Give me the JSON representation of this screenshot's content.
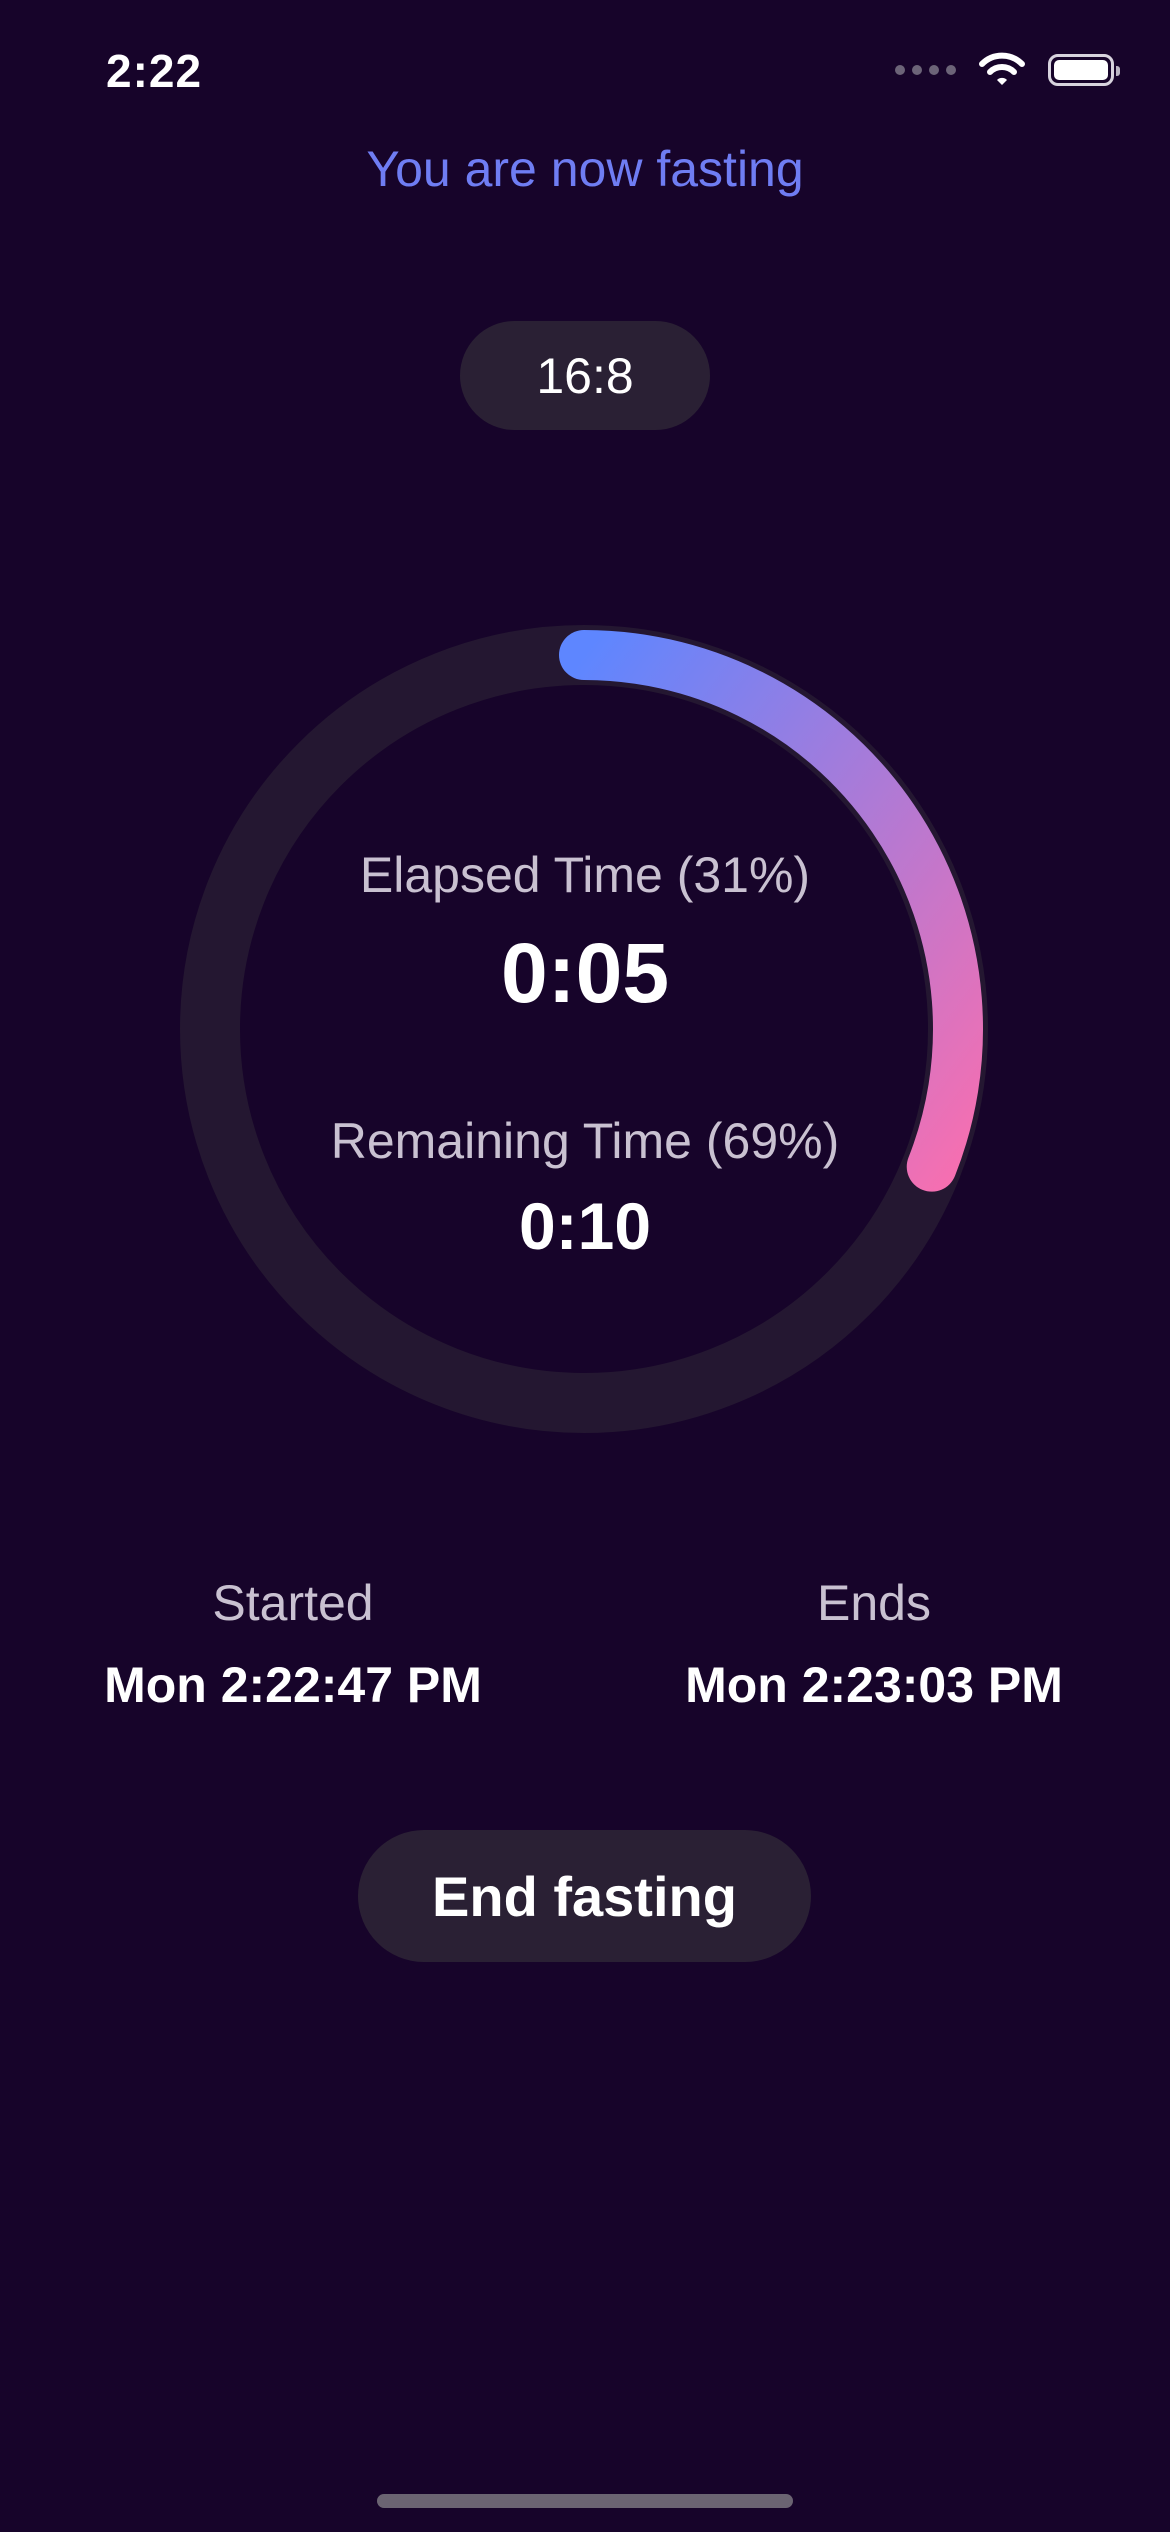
{
  "status_bar": {
    "time": "2:22",
    "icons": [
      "signal-dots-icon",
      "wifi-icon",
      "battery-icon"
    ]
  },
  "header": {
    "title": "You are now fasting"
  },
  "plan": {
    "label": "16:8"
  },
  "progress": {
    "elapsed_label": "Elapsed Time (31%)",
    "elapsed_value": "0:05",
    "remaining_label": "Remaining Time (69%)",
    "remaining_value": "0:10",
    "fraction": 0.31
  },
  "schedule": {
    "started_label": "Started",
    "started_value": "Mon 2:22:47 PM",
    "ends_label": "Ends",
    "ends_value": "Mon 2:23:03 PM"
  },
  "actions": {
    "end_label": "End fasting"
  },
  "colors": {
    "background": "#17042a",
    "accent_blue": "#6f7df3",
    "ring_start": "#5e86ff",
    "ring_end": "#f56fb1",
    "ring_track": "#241731",
    "pill_bg": "#2a2034"
  }
}
